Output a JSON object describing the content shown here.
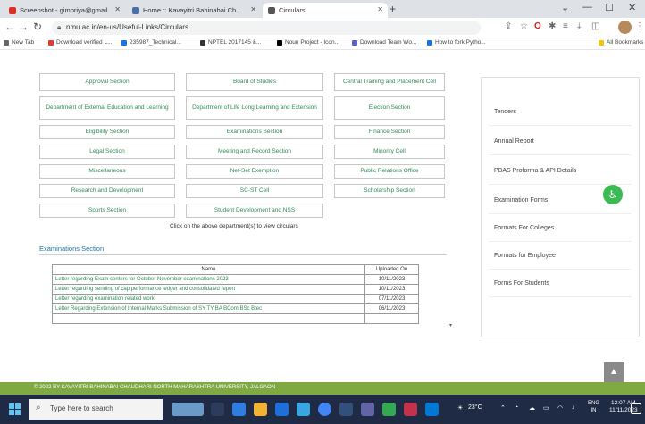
{
  "browser": {
    "tabs": [
      {
        "label": "Screenshot - gimpriya@gmail",
        "color": "#d93025",
        "active": false
      },
      {
        "label": "Home :: Kavayitri Bahinabai Ch...",
        "color": "#4a6fa5",
        "active": false
      },
      {
        "label": "Circulars",
        "color": "#555555",
        "active": true
      }
    ],
    "new_tab_icon": "plus-icon",
    "url": "nmu.ac.in/en-us/Useful-Links/Circulars",
    "bookmarks": [
      {
        "label": "New Tab",
        "color": "#666666"
      },
      {
        "label": "Download verified L...",
        "color": "#e53935"
      },
      {
        "label": "235987_Technical...",
        "color": "#1a73e8"
      },
      {
        "label": "NPTEL 2017145 &...",
        "color": "#333333"
      },
      {
        "label": "Noun Project - Icon...",
        "color": "#000000"
      },
      {
        "label": "Download Team Wo...",
        "color": "#5b5fc7"
      },
      {
        "label": "How to fork Pytho...",
        "color": "#1a73e8"
      }
    ],
    "all_bookmarks": "All Bookmarks"
  },
  "departments": [
    [
      "Approval Section",
      "Board of Studies",
      "Central Training and Placement Cell"
    ],
    [
      "Department of External Education and Learning",
      "Department of Life Long Learning and Extension",
      "Election Section"
    ],
    [
      "Eligibility Section",
      "Examinations Section",
      "Finance Section"
    ],
    [
      "Legal Section",
      "Meeting and Record Section",
      "Minority Cell"
    ],
    [
      "Miscellaneous",
      "Net-Set Exemption",
      "Public Relations Office"
    ],
    [
      "Research and Development",
      "SC-ST Cell",
      "Scholarship Section"
    ],
    [
      "Sports Section",
      "Student Development and NSS",
      ""
    ]
  ],
  "click_note": "Click on the above department(s) to view circulars",
  "exam_section_title": "Examinations Section",
  "table": {
    "headers": [
      "Name",
      "Uploaded On"
    ],
    "rows": [
      [
        "Letter regarding Exam centers for October November examinations 2023",
        "10/11/2023"
      ],
      [
        "Letter regarding sending of cap performance ledger and consolidated report",
        "10/11/2023"
      ],
      [
        "Letter regarding examination related work",
        "07/11/2023"
      ],
      [
        "Letter Regarding Extension of Internal Marks Submission of SY TY BA BCom BSc Btec",
        "06/11/2023"
      ],
      [
        "",
        ""
      ]
    ]
  },
  "sidebar": [
    "Tenders",
    "Annual Report",
    "PBAS Proforma & API Details",
    "Examination Forms",
    "Formats For Colleges",
    "Formats for Employee",
    "Forms For Students"
  ],
  "footer": "© 2022 BY KAVAYITRI BAHINABAI CHAUDHARI NORTH MAHARASHTRA UNIVERSITY, JALGAON",
  "taskbar": {
    "search_placeholder": "Type here to search",
    "weather": "23°C",
    "lang": "ENG",
    "lang2": "IN",
    "time": "12:07 AM",
    "date": "11/11/2023"
  },
  "colors": {
    "accent_green": "#2e8b57",
    "footer_green": "#7fa943",
    "link_blue": "#1a73a8"
  }
}
